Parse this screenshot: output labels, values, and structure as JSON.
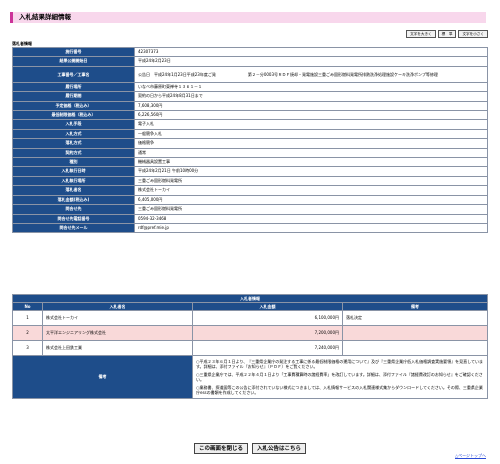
{
  "page": {
    "title": "入札結果詳細情報"
  },
  "font_buttons": {
    "large": "文字を大きく",
    "standard": "標　準",
    "small": "文字を小さく"
  },
  "section_label": "落札者情報",
  "info_rows": [
    {
      "label": "施行番号",
      "value": "42307373"
    },
    {
      "label": "結果公開開始日",
      "value": "平成24年2月23日"
    },
    {
      "label": "工事番号／工事名",
      "value": "公告日　平成24年1月23日平成23年度ご発　　　　　　　　第２－分0003号ＲＤＦ焼却・発電施設三重ごみ固形燃料発電所排熱洗浄処理施設ケーキ洗浄ポンプ等修理"
    },
    {
      "label": "履行場所",
      "value": "いなべ市藤原町東禅寺１３６１－１"
    },
    {
      "label": "履行期間",
      "value": "契約の日から平成24年8月31日まで"
    },
    {
      "label": "予定価格（税込み）",
      "value": "7,608,300円"
    },
    {
      "label": "最低制限価格（税込み）",
      "value": "6,226,560円"
    },
    {
      "label": "入札手段",
      "value": "電子入札"
    },
    {
      "label": "入札方式",
      "value": "一般競争入札"
    },
    {
      "label": "落札方式",
      "value": "価格競争"
    },
    {
      "label": "契約方式",
      "value": "通常"
    },
    {
      "label": "種別",
      "value": "機械器具設置工事"
    },
    {
      "label": "入札執行日時",
      "value": "平成24年2月21日 午前10時00分"
    },
    {
      "label": "入札執行場所",
      "value": "三重ごみ固形燃料発電所"
    },
    {
      "label": "落札者名",
      "value": "株式会社トーカイ"
    },
    {
      "label": "落札金額(税込み)",
      "value": "6,405,000円"
    },
    {
      "label": "問合せ先",
      "value": "三重ごみ固形燃料発電所"
    },
    {
      "label": "問合せ先電話番号",
      "value": "0594-32-3468"
    },
    {
      "label": "問合せ先メール",
      "value": "rdf@pref.mie.jp"
    }
  ],
  "bids": {
    "title": "入札者情報",
    "columns": [
      "No",
      "入札者名",
      "入札金額",
      "備考"
    ],
    "rows": [
      {
        "no": "1",
        "name": "株式会社トーカイ",
        "amount": "6,100,000円",
        "note": "落札決定"
      },
      {
        "no": "2",
        "name": "太平洋エンジニアリング株式会社",
        "amount": "7,200,000円",
        "note": ""
      },
      {
        "no": "3",
        "name": "株式会社上田鉄工業",
        "amount": "7,240,000円",
        "note": ""
      }
    ],
    "remarks_label": "備考",
    "remarks": [
      "○平成２３年６月１日より、『三重県企業庁の発注する工事に係る最低制限価格の運用について』及び『三重県企業庁低入札価格調査実施要領』を見直しています。詳細は、添付ファイル『お知らせ』（ＰＤＦ）をご覧ください。",
      "○三重県企業庁では、平成２２年４月１日より「工事費積算時の諸経費率」を改訂しています。詳細は、添付ファイル『諸経費改訂のお知らせ』をご確認ください。",
      "○業務書、探道図等この公告に添付されていない様式につきましては、入札情報サービスの入札関連様式集からダウンロードしてください。その際、三重県企業庁essの書類を作成してください。"
    ]
  },
  "footer": {
    "close_button": "この画面を閉じる",
    "notice_button": "入札公告はこちら",
    "page_top": "△ページトップへ"
  }
}
